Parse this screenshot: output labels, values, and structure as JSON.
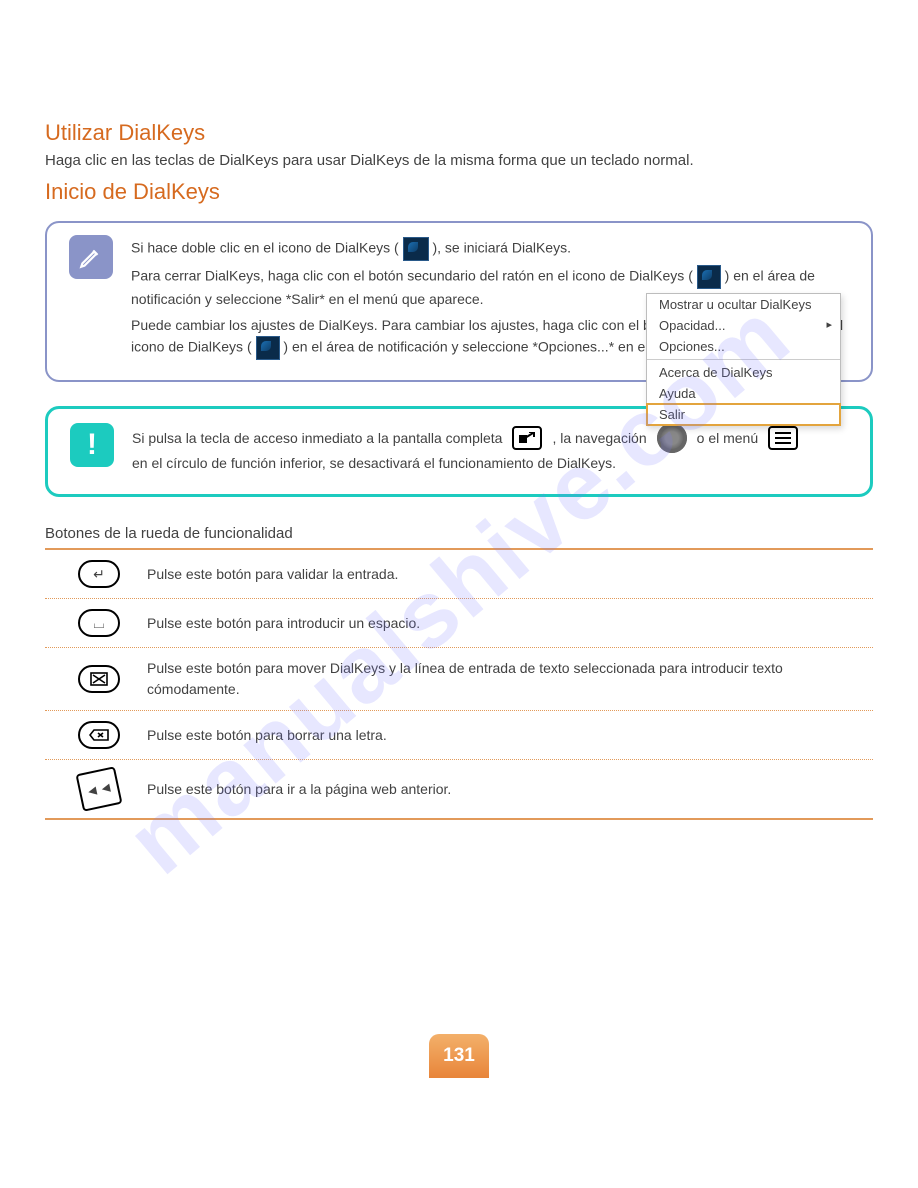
{
  "section": {
    "title1": "Utilizar DialKeys",
    "title2": "Inicio de DialKeys",
    "intro": "Haga clic en las teclas de DialKeys para usar DialKeys de la misma forma que un teclado normal."
  },
  "note": {
    "line1_a": "Si hace doble clic en el icono de DialKeys (",
    "line1_b": "), se iniciará DialKeys.",
    "line2_a": "Para cerrar DialKeys, haga clic con el botón secundario del ratón en el icono de DialKeys (",
    "line2_b": ") en el área de notificación y seleccione *Salir* en el menú que aparece.",
    "line3_a": "Puede cambiar los ajustes de DialKeys. Para cambiar los ajustes, haga clic con el botón secundario del ratón en el icono de DialKeys (",
    "line3_b": ") en el área de notificación y seleccione *Opciones...* en el menú que aparece."
  },
  "context_menu": {
    "items": [
      "Mostrar u ocultar DialKeys",
      "Opacidad...",
      "Opciones...",
      "Acerca de DialKeys",
      "Ayuda",
      "Salir"
    ]
  },
  "alert": {
    "line1_a": "Si pulsa la tecla de acceso inmediato a la pantalla completa",
    "line1_b": ", la navegación",
    "line1_c": "o el menú",
    "line2": "en el círculo de función inferior, se desactivará el funcionamiento de DialKeys."
  },
  "table": {
    "title": "Botones de la rueda de funcionalidad",
    "rows": [
      {
        "symbol": "enter",
        "desc": "Pulse este botón para validar la entrada."
      },
      {
        "symbol": "space",
        "desc": "Pulse este botón para introducir un espacio."
      },
      {
        "symbol": "window",
        "desc": "Pulse este botón para mover DialKeys y la línea de entrada de texto seleccionada para introducir texto cómodamente."
      },
      {
        "symbol": "backspace",
        "desc": "Pulse este botón para borrar una letra."
      },
      {
        "symbol": "pgback",
        "desc": "Pulse este botón para ir a la página web anterior."
      }
    ]
  },
  "page_number": "131"
}
